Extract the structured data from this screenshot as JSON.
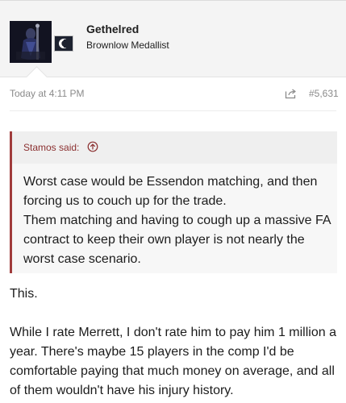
{
  "author": {
    "username": "Gethelred",
    "title": "Brownlow Medallist",
    "avatar_icon": "avatar-image",
    "badge_icon": "club-badge-icon"
  },
  "post": {
    "timestamp": "Today at 4:11 PM",
    "share_icon": "share-icon",
    "number": "#5,631"
  },
  "quote": {
    "author_label": "Stamos said:",
    "jump_icon": "arrow-up-circle-icon",
    "lines": [
      "Worst case would be Essendon matching, and then forcing us to couch up for the trade.",
      "Them matching and having to cough up a massive FA contract to keep their own player is not nearly the worst case scenario."
    ]
  },
  "body": {
    "paragraphs": [
      "This.",
      "While I rate Merrett, I don't rate him to pay him 1 million a year. There's maybe 15 players in the comp I'd be comfortable paying that much money on average, and all of them wouldn't have his injury history."
    ]
  },
  "colors": {
    "quote_accent": "#a03c3c",
    "quote_author": "#8b3030",
    "header_bg": "#f4f4f4",
    "meta_text": "#8a8a8a"
  }
}
